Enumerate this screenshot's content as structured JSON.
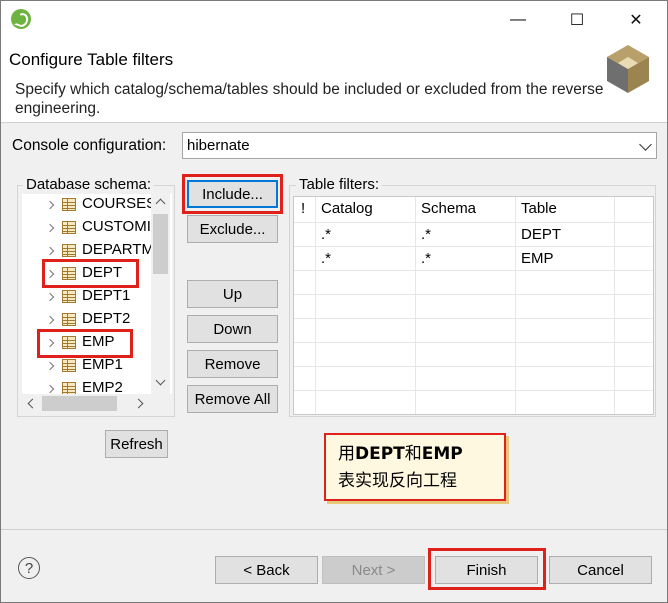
{
  "window": {
    "close_glyph": "✕",
    "maximize_glyph": "☐",
    "minimize_glyph": "—"
  },
  "banner": {
    "title": "Configure Table filters",
    "description": "Specify which catalog/schema/tables should be included or excluded from the reverse engineering."
  },
  "console": {
    "label": "Console configuration:",
    "value": "hibernate"
  },
  "schema": {
    "label": "Database schema:",
    "items": [
      "COURSES",
      "CUSTOMI",
      "DEPARTM",
      "DEPT",
      "DEPT1",
      "DEPT2",
      "EMP",
      "EMP1",
      "EMP2"
    ],
    "highlighted": [
      "DEPT",
      "EMP"
    ]
  },
  "actions": {
    "include": "Include...",
    "exclude": "Exclude...",
    "up": "Up",
    "down": "Down",
    "remove": "Remove",
    "remove_all": "Remove All",
    "refresh": "Refresh"
  },
  "filters": {
    "label": "Table filters:",
    "columns": [
      "!",
      "Catalog",
      "Schema",
      "Table"
    ],
    "rows": [
      {
        "catalog": ".*",
        "schema": ".*",
        "table": "DEPT"
      },
      {
        "catalog": ".*",
        "schema": ".*",
        "table": "EMP"
      }
    ]
  },
  "note": {
    "line1_part1": "用",
    "line1_bold1": "DEPT",
    "line1_part2": "和",
    "line1_bold2": "EMP",
    "line2": "表实现反向工程"
  },
  "footer": {
    "help": "?",
    "back": "< Back",
    "next": "Next >",
    "finish": "Finish",
    "cancel": "Cancel"
  },
  "colors": {
    "highlight_red": "#e0201b",
    "focus_blue": "#0078d7",
    "note_bg": "#fff8e0"
  }
}
